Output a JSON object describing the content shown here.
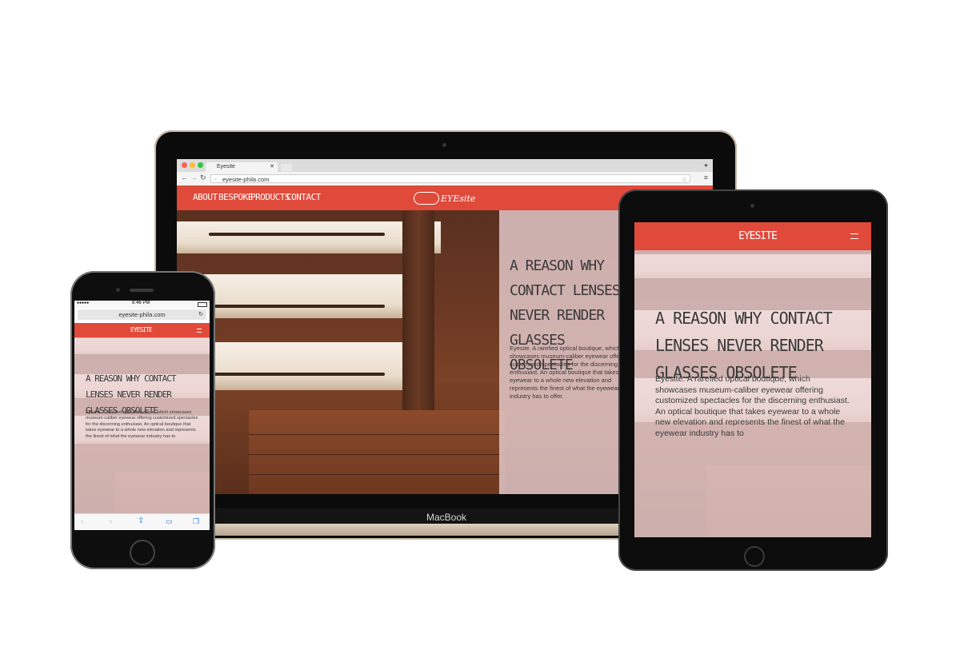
{
  "laptop": {
    "device_label": "MacBook",
    "browser": {
      "tab_title": "Eyesite",
      "url": "eyesite-phila.com"
    },
    "nav": {
      "items": [
        "ABOUT",
        "BESPOKE",
        "PRODUCTS",
        "CONTACT"
      ],
      "logo": "EYEsite"
    },
    "hero": {
      "heading": "A REASON WHY CONTACT LENSES NEVER RENDER GLASSES OBSOLETE",
      "body": "Eyesite. A rarefied optical boutique, which showcases museum-caliber eyewear offering customized spectacles for the discerning enthusiast. An optical boutique that takes eyewear to a whole new elevation and represents the finest of what the eyewear industry has to offer."
    }
  },
  "phone": {
    "status_time": "8:46 PM",
    "url": "eyesite-phila.com",
    "logo": "EYESITE",
    "hero": {
      "heading": "A REASON WHY CONTACT LENSES NEVER RENDER GLASSES OBSOLETE",
      "body": "Eyesite. A rarefied optical boutique, which showcases museum-caliber eyewear offering customized spectacles for the discerning enthusiast. An optical boutique that takes eyewear to a whole new elevation and represents the finest of what the eyewear industry has to"
    },
    "toolbar_icons": [
      "back-icon",
      "forward-icon",
      "share-icon",
      "bookmarks-icon",
      "tabs-icon"
    ]
  },
  "tablet": {
    "logo": "EYESITE",
    "hero": {
      "heading": "A REASON WHY CONTACT LENSES NEVER RENDER GLASSES OBSOLETE",
      "body": "Eyesite. A rarefied optical boutique, which showcases museum-caliber eyewear offering customized spectacles for the discerning enthusiast. An optical boutique that takes eyewear to a whole new elevation and represents the finest of what the eyewear industry has to"
    }
  },
  "colors": {
    "brand_red": "#e04a3b",
    "overlay_pink": "#ecd4d6",
    "text_dark": "#3a3a3a"
  }
}
